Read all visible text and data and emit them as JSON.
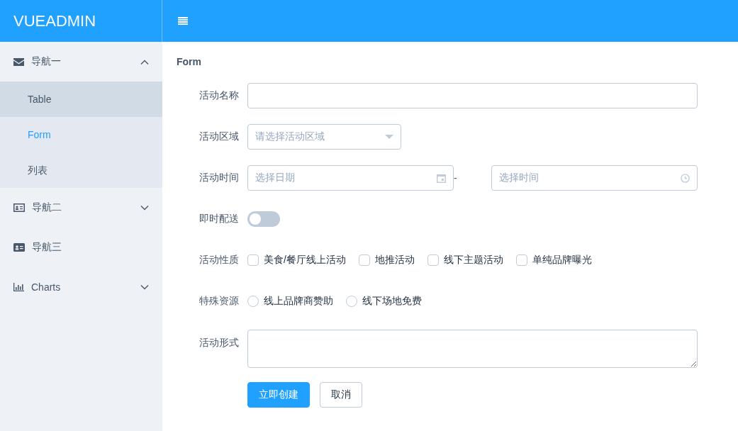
{
  "header": {
    "logo": "VUEADMIN"
  },
  "sidebar": {
    "items": [
      {
        "label": "导航一",
        "expanded": true,
        "children": [
          {
            "label": "Table",
            "selected": false,
            "hovered": true
          },
          {
            "label": "Form",
            "selected": true,
            "hovered": false
          },
          {
            "label": "列表",
            "selected": false,
            "hovered": false
          }
        ]
      },
      {
        "label": "导航二",
        "expanded": false
      },
      {
        "label": "导航三"
      },
      {
        "label": "Charts",
        "expanded": false
      }
    ]
  },
  "page_title": "Form",
  "form": {
    "fields": [
      {
        "kind": "text",
        "label": "活动名称"
      },
      {
        "kind": "select",
        "label": "活动区域",
        "placeholder": "请选择活动区域"
      },
      {
        "kind": "datetime",
        "label": "活动时间",
        "date_placeholder": "选择日期",
        "separator": "-",
        "time_placeholder": "选择时间"
      },
      {
        "kind": "switch",
        "label": "即时配送",
        "on": false
      },
      {
        "kind": "checkboxes",
        "label": "活动性质",
        "options": [
          {
            "label": "美食/餐厅线上活动",
            "checked": false
          },
          {
            "label": "地推活动",
            "checked": false
          },
          {
            "label": "线下主题活动",
            "checked": false
          },
          {
            "label": "单纯品牌曝光",
            "checked": false
          }
        ]
      },
      {
        "kind": "radios",
        "label": "特殊资源",
        "options": [
          {
            "label": "线上品牌商赞助",
            "selected": false
          },
          {
            "label": "线下场地免费",
            "selected": false
          }
        ]
      },
      {
        "kind": "textarea",
        "label": "活动形式"
      }
    ],
    "buttons": [
      {
        "label": "立即创建",
        "primary": true
      },
      {
        "label": "取消",
        "primary": false
      }
    ]
  }
}
